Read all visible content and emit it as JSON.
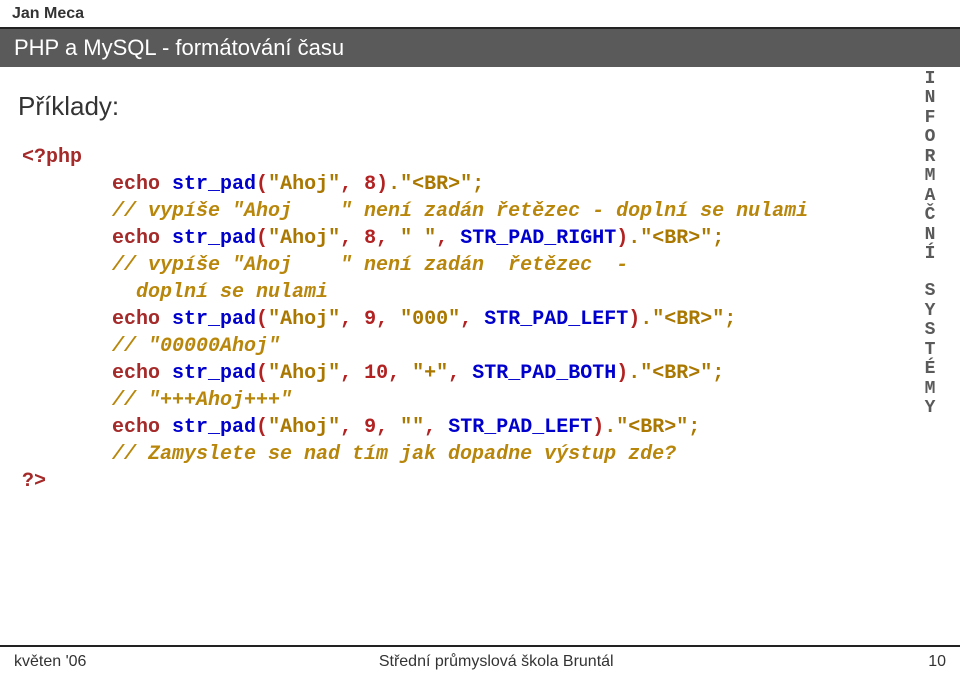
{
  "author": "Jan Meca",
  "title": "PHP a MySQL - formátování času",
  "subtitle": "Příklady:",
  "sidebar_letters_top": [
    "I",
    "N",
    "F",
    "O",
    "R",
    "M",
    "A",
    "Č",
    "N",
    "Í"
  ],
  "sidebar_letters_bottom": [
    "S",
    "Y",
    "S",
    "T",
    "É",
    "M",
    "Y"
  ],
  "code": {
    "l01": {
      "kw": "<?php"
    },
    "l02": {
      "kw": "echo",
      "fn": "str_pad",
      "s1": "\"Ahoj\"",
      "n1": "8",
      "tail": ".\"<BR>\";"
    },
    "l03": {
      "cm": "// vypíše \"Ahoj    \" není zadán řetězec - doplní se nulami"
    },
    "l04": {
      "kw": "echo",
      "fn": "str_pad",
      "s1": "\"Ahoj\"",
      "n1": "8",
      "s2": "\" \"",
      "c1": "STR_PAD_RIGHT",
      "tail": ".\"<BR>\";"
    },
    "l05": {
      "cm": "// vypíše \"Ahoj    \" není zadán  řetězec  -"
    },
    "l06": {
      "cm": "doplní se nulami"
    },
    "l07": {
      "kw": "echo",
      "fn": "str_pad",
      "s1": "\"Ahoj\"",
      "n1": "9",
      "s2": "\"000\"",
      "c1": "STR_PAD_LEFT",
      "tail": ".\"<BR>\";"
    },
    "l08": {
      "cm": "// \"00000Ahoj\""
    },
    "l09": {
      "kw": "echo",
      "fn": "str_pad",
      "s1": "\"Ahoj\"",
      "n1": "10",
      "s2": "\"+\"",
      "c1": "STR_PAD_BOTH",
      "tail": ".\"<BR>\";"
    },
    "l10": {
      "cm": "// \"+++Ahoj+++\""
    },
    "l11": {
      "kw": "echo",
      "fn": "str_pad",
      "s1": "\"Ahoj\"",
      "n1": "9",
      "s2": "\"\"",
      "c1": "STR_PAD_LEFT",
      "tail": ".\"<BR>\";"
    },
    "l12": {
      "cm": "// Zamyslete se nad tím jak dopadne výstup zde?"
    },
    "l13": {
      "kw": "?>"
    }
  },
  "footer": {
    "left": "květen '06",
    "center": "Střední průmyslová škola Bruntál",
    "right": "10"
  }
}
